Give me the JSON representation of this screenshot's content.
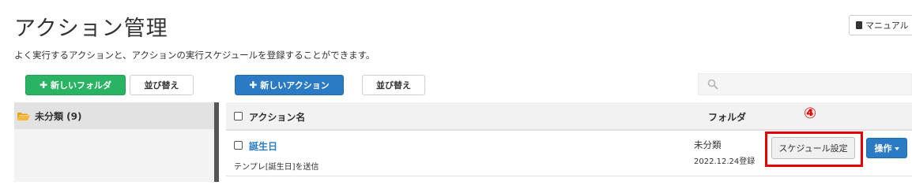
{
  "header": {
    "title": "アクション管理",
    "description": "よく実行するアクションと、アクションの実行スケジュールを登録することができます。",
    "manual_label": "マニュアル"
  },
  "toolbar": {
    "new_folder_label": "新しいフォルダ",
    "sort_folder_label": "並び替え",
    "new_action_label": "新しいアクション",
    "sort_action_label": "並び替え"
  },
  "search": {
    "placeholder": ""
  },
  "sidebar": {
    "folders": [
      {
        "label": "未分類 (9)"
      }
    ]
  },
  "table": {
    "columns": {
      "name": "アクション名",
      "folder": "フォルダ"
    },
    "rows": [
      {
        "name": "誕生日",
        "sub": "テンプレ[誕生日]を送信",
        "folder": "未分類",
        "date": "2022.12.24登録",
        "schedule_label": "スケジュール設定",
        "ops_label": "操作"
      }
    ]
  },
  "annotation": {
    "step": "④"
  },
  "colors": {
    "green": "#28b463",
    "blue": "#2b7bc4",
    "highlight_red": "#e60000"
  }
}
